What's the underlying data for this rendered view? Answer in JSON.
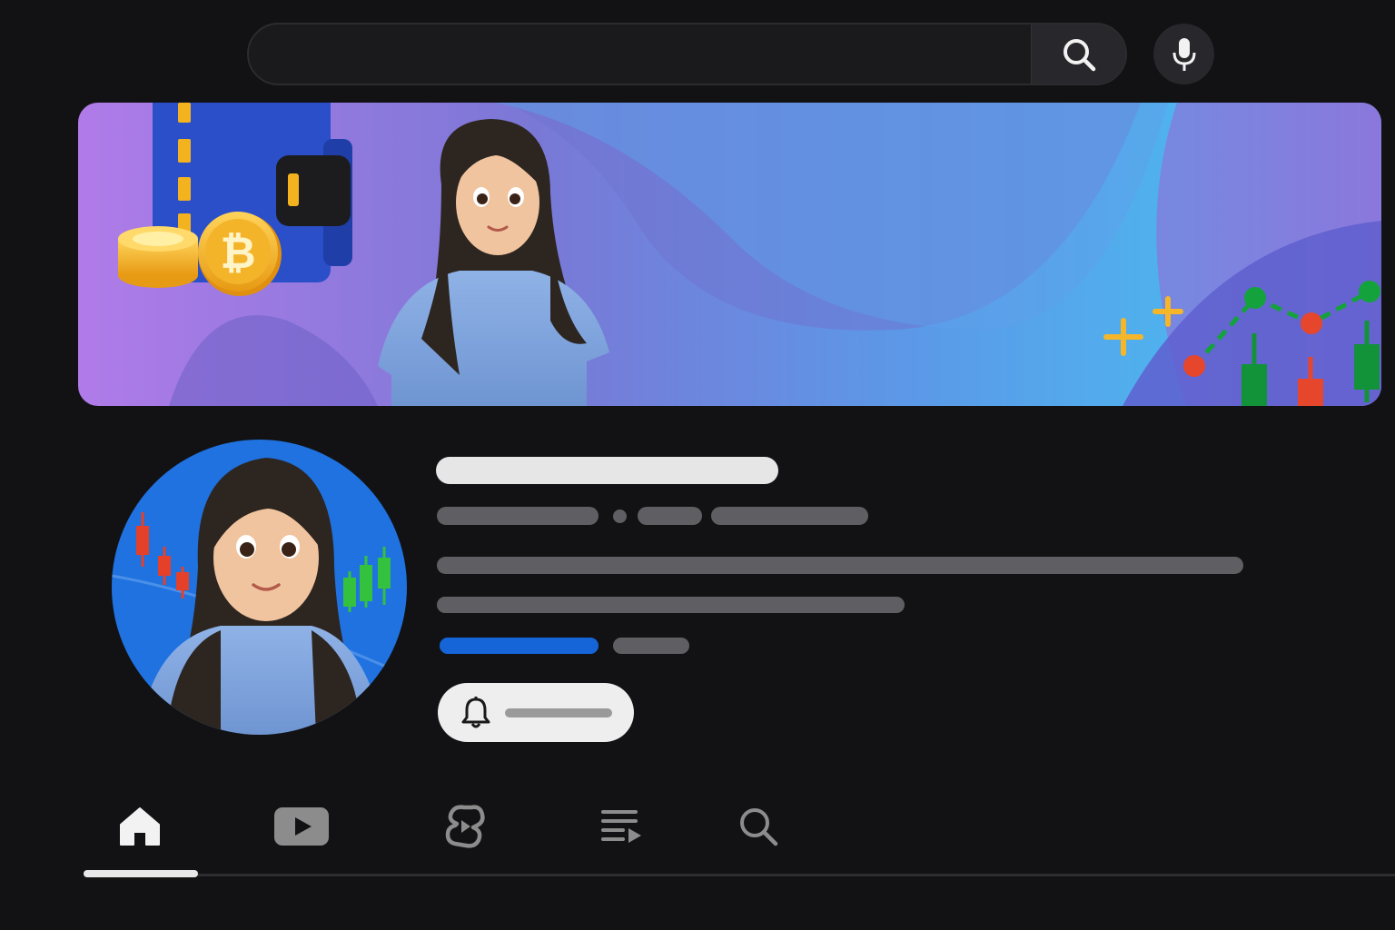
{
  "search": {
    "placeholder": "",
    "button_icon": "search-icon",
    "mic_icon": "mic-icon"
  },
  "banner": {
    "description_icons": [
      "wallet-icon",
      "bitcoin-coin-icon",
      "candlestick-chart-icon"
    ]
  },
  "channel": {
    "name": "",
    "handle": "",
    "subscribers": "",
    "videos": "",
    "description": "",
    "link": "",
    "more": ""
  },
  "subscribe": {
    "icon": "bell-icon",
    "label": ""
  },
  "tabs": [
    {
      "icon": "home-icon",
      "active": true
    },
    {
      "icon": "videos-icon",
      "active": false
    },
    {
      "icon": "shorts-icon",
      "active": false
    },
    {
      "icon": "playlists-icon",
      "active": false
    },
    {
      "icon": "search-icon",
      "active": false
    }
  ],
  "colors": {
    "background": "#121214",
    "accent_link": "#1565d8",
    "subscribe_bg": "#eeeeee"
  }
}
